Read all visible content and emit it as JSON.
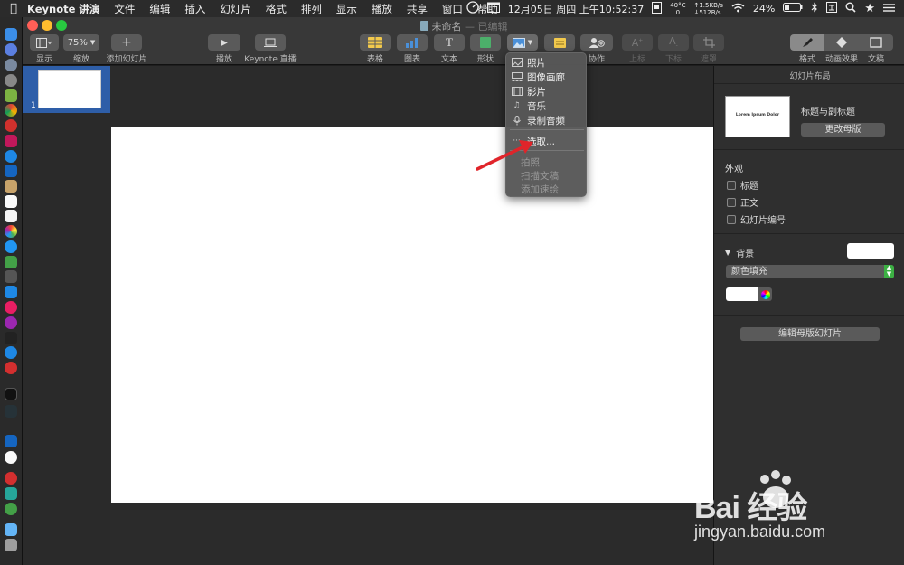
{
  "menubar": {
    "app_name": "Keynote 讲演",
    "items": [
      "文件",
      "编辑",
      "插入",
      "幻灯片",
      "格式",
      "排列",
      "显示",
      "播放",
      "共享",
      "窗口",
      "帮助"
    ],
    "temp_top": "40°C",
    "temp_bottom": "0",
    "date_time": "12月05日 周四 上午10:52:37",
    "net_up": "↑1.5KB/s",
    "net_down": "↓512B/s",
    "battery": "24%"
  },
  "window": {
    "title": "未命名",
    "title_suffix": "— 已编辑"
  },
  "toolbar": {
    "view_label": "显示",
    "zoom_value": "75%",
    "zoom_label": "缩放",
    "add_slide_label": "添加幻灯片",
    "play_label": "播放",
    "live_label": "Keynote 直播",
    "table_label": "表格",
    "chart_label": "图表",
    "text_label": "文本",
    "shape_label": "形状",
    "collab_label": "协作",
    "superscript_label": "上标",
    "subscript_label": "下标",
    "mask_label": "遮罩",
    "format_label": "格式",
    "animate_label": "动画效果",
    "document_label": "文稿"
  },
  "navigator": {
    "slide_number": "1"
  },
  "inspector": {
    "title": "幻灯片布局",
    "layout_thumb_text": "Lorem Ipsum Dolor",
    "layout_name": "标题与副标题",
    "change_master": "更改母版",
    "appearance": "外观",
    "options": [
      "标题",
      "正文",
      "幻灯片编号"
    ],
    "background": "背景",
    "fill_type": "颜色填充",
    "edit_master": "编辑母版幻灯片"
  },
  "media_menu": {
    "items": [
      {
        "label": "照片",
        "icon": "photo-icon"
      },
      {
        "label": "图像画廊",
        "icon": "gallery-icon"
      },
      {
        "label": "影片",
        "icon": "film-icon"
      },
      {
        "label": "音乐",
        "icon": "music-icon"
      },
      {
        "label": "录制音频",
        "icon": "microphone-icon"
      }
    ],
    "choose": "选取...",
    "disabled_items": [
      "拍照",
      "扫描文稿",
      "添加速绘"
    ]
  },
  "watermark": {
    "main": "Bai 经验",
    "sub": "jingyan.baidu.com"
  },
  "colors": {
    "accent_blue": "#2e5ea8",
    "table_yellow": "#f2c94c",
    "chart_blue": "#4a90d9",
    "shape_green": "#4caf6a",
    "comment_yellow": "#f2c94c",
    "arrow_red": "#e0242a"
  }
}
